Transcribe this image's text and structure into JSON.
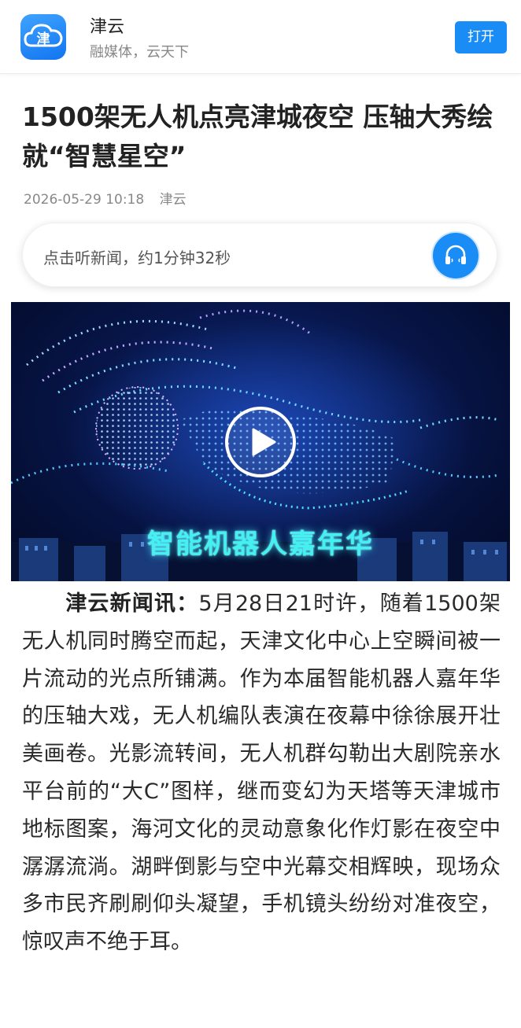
{
  "header": {
    "app_name": "津云",
    "slogan": "融媒体，云天下",
    "open_label": "打开",
    "logo_icon": "jinyun-logo-icon",
    "brand_color": "#1a8cf5"
  },
  "article": {
    "title": "1500架无人机点亮津城夜空 压轴大秀绘就“智慧星空”",
    "date": "2026-05-29 10:18",
    "source": "津云"
  },
  "listen": {
    "text": "点击听新闻，约1分钟32秒",
    "icon": "headphones-icon"
  },
  "video": {
    "caption": "智能机器人嘉年华",
    "play_icon": "play-icon"
  },
  "body": {
    "lead": "津云新闻讯：",
    "text": "5月28日21时许，随着1500架无人机同时腾空而起，天津文化中心上空瞬间被一片流动的光点所铺满。作为本届智能机器人嘉年华的压轴大戏，无人机编队表演在夜幕中徐徐展开壮美画卷。光影流转间，无人机群勾勒出大剧院亲水平台前的“大C”图样，继而变幻为天塔等天津城市地标图案，海河文化的灵动意象化作灯影在夜空中潺潺流淌。湖畔倒影与空中光幕交相辉映，现场众多市民齐刷刷仰头凝望，手机镜头纷纷对准夜空，惊叹声不绝于耳。"
  }
}
